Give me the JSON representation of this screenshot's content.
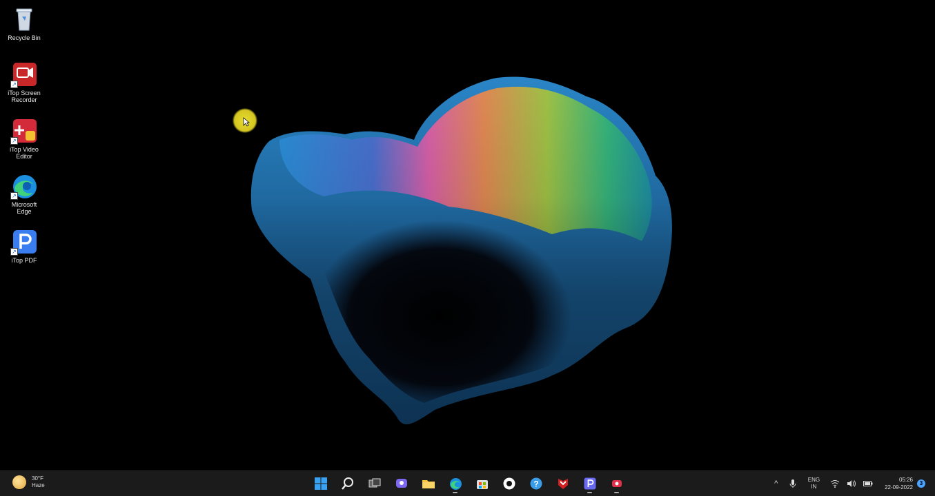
{
  "desktop_icons": [
    {
      "label": "Recycle Bin",
      "icon": "recycle-bin-icon"
    },
    {
      "label": "iTop Screen\nRecorder",
      "icon": "screen-recorder-icon"
    },
    {
      "label": "iTop Video\nEditor",
      "icon": "video-editor-icon"
    },
    {
      "label": "Microsoft\nEdge",
      "icon": "edge-icon"
    },
    {
      "label": "iTop PDF",
      "icon": "pdf-icon"
    }
  ],
  "weather": {
    "temp": "30°F",
    "condition": "Haze"
  },
  "taskbar_apps": [
    "start-icon",
    "search-icon",
    "task-view-icon",
    "chat-icon",
    "file-explorer-icon",
    "edge-icon",
    "store-icon",
    "media-icon",
    "help-icon",
    "antivirus-icon",
    "pdf-icon",
    "recorder-icon"
  ],
  "tray": {
    "lang_line1": "ENG",
    "lang_line2": "IN",
    "time": "05:26",
    "date": "22-09-2022"
  },
  "colors": {
    "taskbar": "#1b1b1b",
    "accent": "#4aa3ff"
  }
}
